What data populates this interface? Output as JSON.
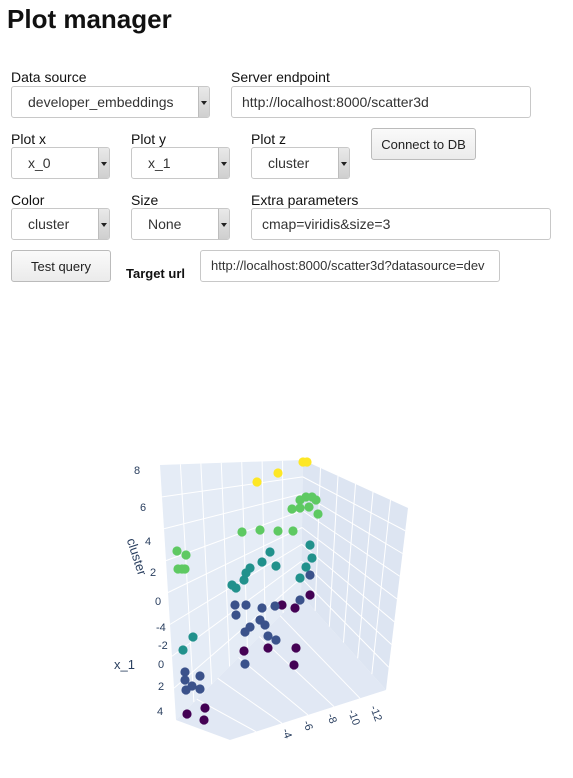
{
  "page": {
    "title": "Plot manager"
  },
  "form": {
    "data_source": {
      "label": "Data source",
      "value": "developer_embeddings"
    },
    "server_endpoint": {
      "label": "Server endpoint",
      "value": "http://localhost:8000/scatter3d"
    },
    "plot_x": {
      "label": "Plot x",
      "value": "x_0"
    },
    "plot_y": {
      "label": "Plot y",
      "value": "x_1"
    },
    "plot_z": {
      "label": "Plot z",
      "value": "cluster"
    },
    "connect_label": "Connect to DB",
    "color": {
      "label": "Color",
      "value": "cluster"
    },
    "size": {
      "label": "Size",
      "value": "None"
    },
    "extra": {
      "label": "Extra parameters",
      "value": "cmap=viridis&size=3"
    },
    "test_query_label": "Test query",
    "target_url": {
      "label": "Target url",
      "value": "http://localhost:8000/scatter3d?datasource=dev"
    }
  },
  "chart_data": {
    "type": "scatter",
    "colormap": "viridis",
    "colors": [
      "#440154",
      "#3b528b",
      "#21918c",
      "#5ec962",
      "#fde725"
    ],
    "z_axis": {
      "label": "cluster",
      "ticks": [
        "8",
        "6",
        "4",
        "2",
        "0"
      ]
    },
    "y_axis": {
      "label": "x_1",
      "ticks": [
        "-4",
        "-2",
        "0",
        "2",
        "4"
      ]
    },
    "x_axis": {
      "ticks": [
        "-4",
        "-6",
        "-8",
        "-10",
        "-12"
      ]
    }
  }
}
